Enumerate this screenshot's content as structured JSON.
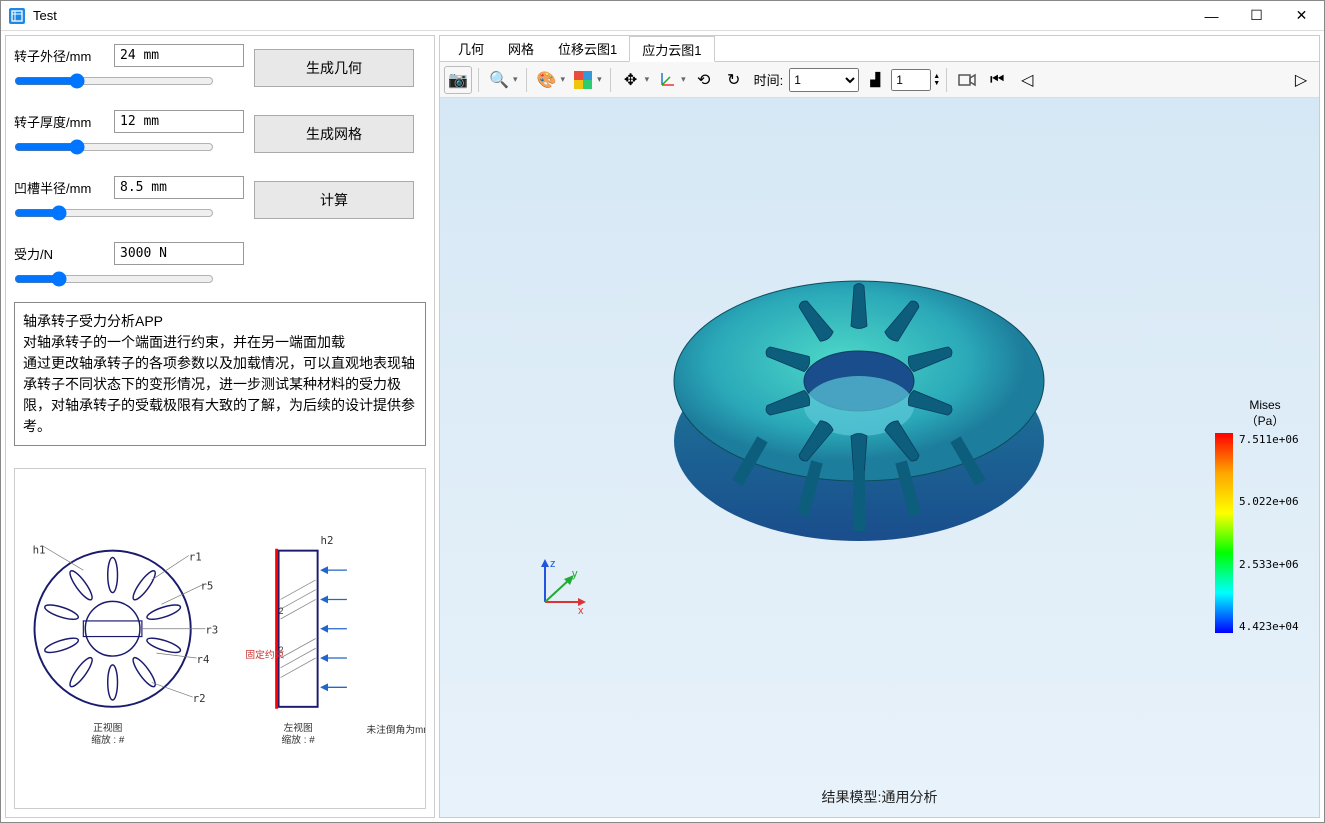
{
  "window": {
    "title": "Test"
  },
  "form": {
    "outer_radius": {
      "label": "转子外径/mm",
      "value": "24 mm"
    },
    "thickness": {
      "label": "转子厚度/mm",
      "value": "12 mm"
    },
    "groove": {
      "label": "凹槽半径/mm",
      "value": "8.5 mm"
    },
    "force": {
      "label": "受力/N",
      "value": "3000 N"
    },
    "btn_geom": "生成几何",
    "btn_mesh": "生成网格",
    "btn_calc": "计算"
  },
  "description": "轴承转子受力分析APP\n对轴承转子的一个端面进行约束，并在另一端面加载\n通过更改轴承转子的各项参数以及加载情况，可以直观地表现轴承转子不同状态下的变形情况，进一步测试某种材料的受力极限，对轴承转子的受载极限有大致的了解，为后续的设计提供参考。",
  "schematic": {
    "labels": {
      "h1": "h1",
      "h2": "h2",
      "r1": "r1",
      "r2": "r2",
      "r3": "r3",
      "r4": "r4",
      "r5": "r5",
      "front_title": "正视图",
      "front_sub": "缩放 :   #",
      "left_title": "左视图",
      "left_sub": "缩放 :   #",
      "chamfer": "未注倒角为mm",
      "constraint": "固定约束"
    }
  },
  "tabs": {
    "items": [
      {
        "label": "几何"
      },
      {
        "label": "网格"
      },
      {
        "label": "位移云图1"
      },
      {
        "label": "应力云图1"
      }
    ],
    "active": 3
  },
  "toolbar": {
    "time_label": "时间:",
    "time_options": [
      "1"
    ],
    "time_value": "1",
    "step_value": "1"
  },
  "viewport": {
    "result_label": "结果模型:通用分析",
    "axes": {
      "x": "x",
      "y": "y",
      "z": "z"
    },
    "legend": {
      "title1": "Mises",
      "title2": "（Pa）",
      "ticks": [
        "7.511e+06",
        "5.022e+06",
        "2.533e+06",
        "4.423e+04"
      ]
    }
  }
}
